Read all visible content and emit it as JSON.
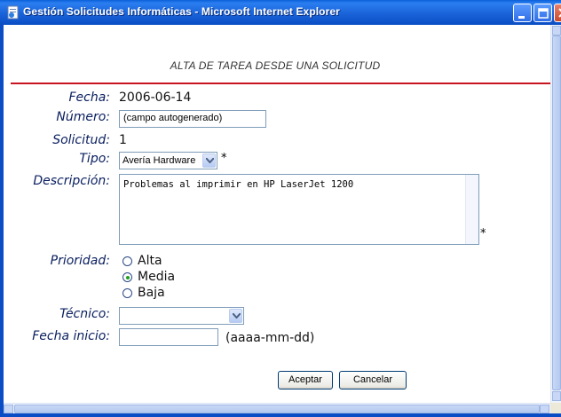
{
  "window": {
    "title": "Gestión Solicitudes Informáticas - Microsoft Internet Explorer",
    "accent_color": "#0a4dc4"
  },
  "form": {
    "heading": "ALTA DE TAREA DESDE UNA SOLICITUD",
    "divider_color": "#c8141e",
    "fecha": {
      "label": "Fecha:",
      "value": "2006-06-14"
    },
    "numero": {
      "label": "Número:",
      "value": "(campo autogenerado)"
    },
    "solicitud": {
      "label": "Solicitud:",
      "value": "1"
    },
    "tipo": {
      "label": "Tipo:",
      "selected": "Avería Hardware",
      "required_mark": "*"
    },
    "descripcion": {
      "label": "Descripción:",
      "value": "Problemas al imprimir en HP LaserJet 1200",
      "required_mark": "*"
    },
    "prioridad": {
      "label": "Prioridad:",
      "options": [
        "Alta",
        "Media",
        "Baja"
      ],
      "selected": "Media"
    },
    "tecnico": {
      "label": "Técnico:",
      "selected": ""
    },
    "fecha_inicio": {
      "label": "Fecha inicio:",
      "value": "",
      "hint": "(aaaa-mm-dd)"
    },
    "buttons": {
      "accept": "Aceptar",
      "cancel": "Cancelar"
    }
  },
  "icons": {
    "window": "ie-page-icon",
    "minimize": "minimize-icon",
    "maximize": "maximize-icon",
    "close": "close-icon",
    "dropdown": "chevron-down-icon"
  }
}
